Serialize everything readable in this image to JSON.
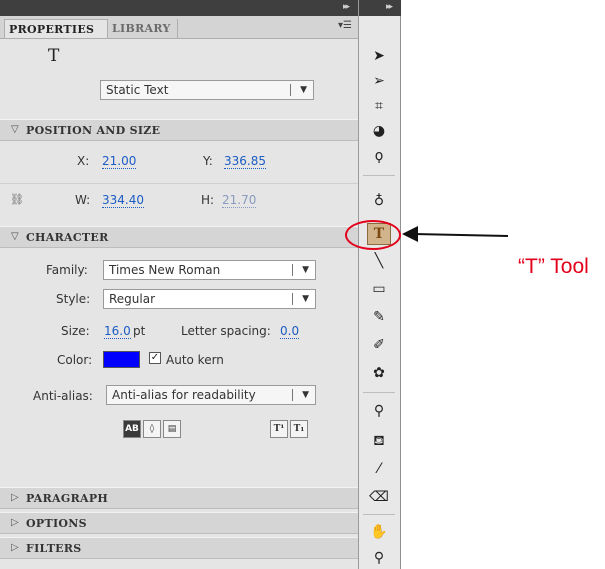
{
  "panel": {
    "tabs": [
      "PROPERTIES",
      "LIBRARY"
    ],
    "menu_icon": "panel-menu-icon",
    "instance": {
      "tool_glyph": "T",
      "text_type": "Static Text"
    },
    "position_and_size": {
      "title": "POSITION AND SIZE",
      "x_label": "X:",
      "x": "21.00",
      "y_label": "Y:",
      "y": "336.85",
      "w_label": "W:",
      "w": "334.40",
      "h_label": "H:",
      "h": "21.70"
    },
    "character": {
      "title": "CHARACTER",
      "family_label": "Family:",
      "family": "Times New Roman",
      "style_label": "Style:",
      "style": "Regular",
      "size_label": "Size:",
      "size": "16.0",
      "size_unit": "pt",
      "letter_spacing_label": "Letter spacing:",
      "letter_spacing": "0.0",
      "color_label": "Color:",
      "color_value": "#0000FF",
      "auto_kern_label": "Auto kern",
      "auto_kern_checked": true,
      "anti_alias_label": "Anti-alias:",
      "anti_alias": "Anti-alias for readability",
      "buttons": [
        "AB",
        "◊",
        "▤",
        "T¹",
        "T₁"
      ]
    },
    "collapsed_sections": [
      "PARAGRAPH",
      "OPTIONS",
      "FILTERS"
    ]
  },
  "toolbar": {
    "tools": [
      "selection-tool",
      "subselection-tool",
      "free-transform-tool",
      "3d-rotation-tool",
      "lasso-tool",
      "pen-tool",
      "text-tool",
      "line-tool",
      "rectangle-tool",
      "pencil-tool",
      "brush-tool",
      "deco-tool",
      "bone-tool",
      "paint-bucket-tool",
      "eyedropper-tool",
      "eraser-tool",
      "hand-tool",
      "zoom-tool"
    ],
    "selected": "text-tool"
  },
  "annotation": {
    "label": "“T” Tool",
    "color": "#E3001B"
  }
}
